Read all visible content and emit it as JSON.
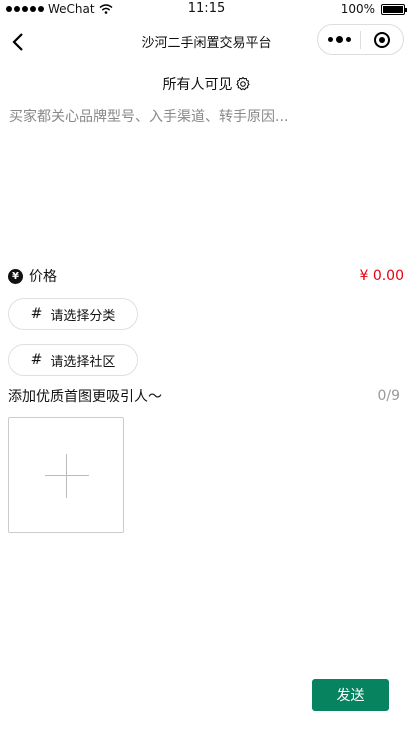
{
  "status_bar": {
    "carrier": "WeChat",
    "time": "11:15",
    "battery": "100%",
    "battery_level": 1.0
  },
  "nav": {
    "title": "沙河二手闲置交易平台",
    "back_icon": "chevron-left-icon",
    "more_icon": "more-dots-icon",
    "close_icon": "target-close-icon"
  },
  "visibility": {
    "label": "所有人可见",
    "icon": "gear-icon"
  },
  "description": {
    "placeholder": "买家都关心品牌型号、入手渠道、转手原因..."
  },
  "price": {
    "label": "价格",
    "value": "¥ 0.00",
    "icon": "yen-icon",
    "color": "#e60012"
  },
  "chips": {
    "category": "请选择分类",
    "community": "请选择社区",
    "icon": "hash-icon"
  },
  "images": {
    "label": "添加优质首图更吸引人～",
    "count": "0/9"
  },
  "actions": {
    "send": "发送",
    "send_color": "#07845f"
  }
}
